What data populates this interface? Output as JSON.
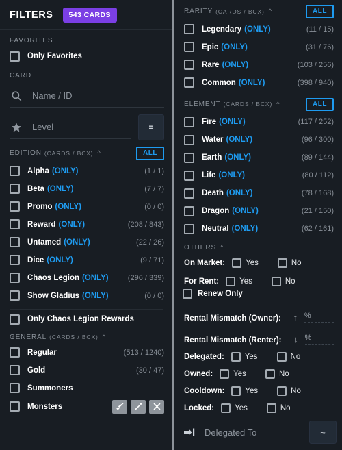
{
  "header": {
    "title": "FILTERS",
    "cards_badge": "543 CARDS",
    "badge_color": "#7b3fe4"
  },
  "accent": {
    "blue": "#1e9bf0",
    "purple": "#7b3fe4"
  },
  "left": {
    "favorites": {
      "label": "FAVORITES",
      "only_favorites": "Only Favorites"
    },
    "card": {
      "label": "CARD",
      "search_placeholder": "Name / ID",
      "search_icon": "search-icon",
      "level_placeholder": "Level",
      "level_icon": "star-icon",
      "equals_button": "="
    },
    "edition": {
      "label": "EDITION",
      "sub": "(CARDS / BCX)",
      "all": "ALL",
      "items": [
        {
          "name": "Alpha",
          "only": "(ONLY)",
          "count": "(1 / 1)"
        },
        {
          "name": "Beta",
          "only": "(ONLY)",
          "count": "(7 / 7)"
        },
        {
          "name": "Promo",
          "only": "(ONLY)",
          "count": "(0 / 0)"
        },
        {
          "name": "Reward",
          "only": "(ONLY)",
          "count": "(208 / 843)"
        },
        {
          "name": "Untamed",
          "only": "(ONLY)",
          "count": "(22 / 26)"
        },
        {
          "name": "Dice",
          "only": "(ONLY)",
          "count": "(9 / 71)"
        },
        {
          "name": "Chaos Legion",
          "only": "(ONLY)",
          "count": "(296 / 339)"
        },
        {
          "name": "Show Gladius",
          "only": "(ONLY)",
          "count": "(0 / 0)"
        }
      ],
      "only_chaos_legion_rewards": "Only Chaos Legion Rewards"
    },
    "general": {
      "label": "GENERAL",
      "sub": "(CARDS / BCX)",
      "items": [
        {
          "name": "Regular",
          "count": "(513 / 1240)"
        },
        {
          "name": "Gold",
          "count": "(30 / 47)"
        },
        {
          "name": "Summoners",
          "count": ""
        },
        {
          "name": "Monsters",
          "count": ""
        }
      ],
      "attack_icons": [
        "melee-attack-icon",
        "ranged-attack-icon",
        "magic-attack-icon"
      ]
    }
  },
  "right": {
    "rarity": {
      "label": "RARITY",
      "sub": "(CARDS / BCX)",
      "all": "ALL",
      "items": [
        {
          "name": "Legendary",
          "only": "(ONLY)",
          "count": "(11 / 15)"
        },
        {
          "name": "Epic",
          "only": "(ONLY)",
          "count": "(31 / 76)"
        },
        {
          "name": "Rare",
          "only": "(ONLY)",
          "count": "(103 / 256)"
        },
        {
          "name": "Common",
          "only": "(ONLY)",
          "count": "(398 / 940)"
        }
      ]
    },
    "element": {
      "label": "ELEMENT",
      "sub": "(CARDS / BCX)",
      "all": "ALL",
      "items": [
        {
          "name": "Fire",
          "only": "(ONLY)",
          "count": "(117 / 252)"
        },
        {
          "name": "Water",
          "only": "(ONLY)",
          "count": "(96 / 300)"
        },
        {
          "name": "Earth",
          "only": "(ONLY)",
          "count": "(89 / 144)"
        },
        {
          "name": "Life",
          "only": "(ONLY)",
          "count": "(80 / 112)"
        },
        {
          "name": "Death",
          "only": "(ONLY)",
          "count": "(78 / 168)"
        },
        {
          "name": "Dragon",
          "only": "(ONLY)",
          "count": "(21 / 150)"
        },
        {
          "name": "Neutral",
          "only": "(ONLY)",
          "count": "(62 / 161)"
        }
      ]
    },
    "others": {
      "label": "OTHERS",
      "yes": "Yes",
      "no": "No",
      "on_market": "On Market:",
      "for_rent": "For Rent:",
      "renew_only": "Renew Only",
      "rental_mismatch_owner": "Rental Mismatch (Owner):",
      "rental_mismatch_owner_arrow": "↑",
      "rental_mismatch_renter": "Rental Mismatch (Renter):",
      "rental_mismatch_renter_arrow": "↓",
      "percent": "%",
      "delegated": "Delegated:",
      "owned": "Owned:",
      "cooldown": "Cooldown:",
      "locked": "Locked:",
      "delegated_to_placeholder": "Delegated To",
      "delegated_to_icon": "login-arrow-icon",
      "tilde_button": "~"
    }
  }
}
